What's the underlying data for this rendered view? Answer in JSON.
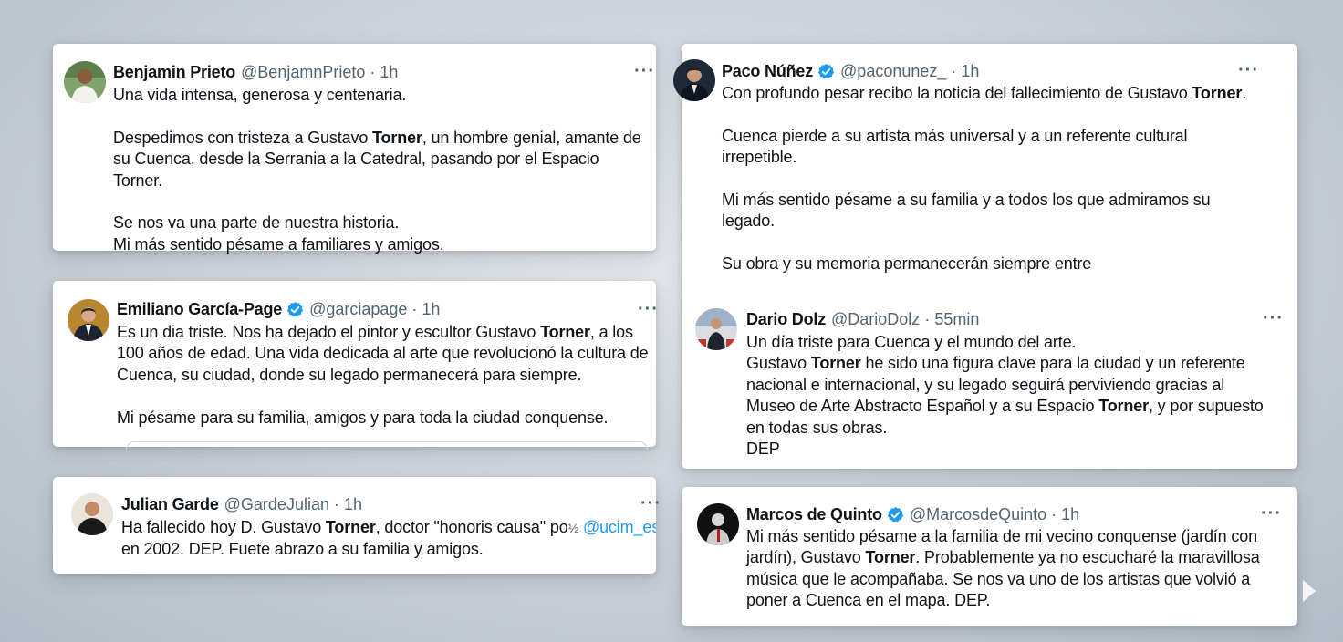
{
  "tweets": [
    {
      "name": "Benjamin Prieto",
      "handle": "@BenjamnPrieto",
      "time": "1h",
      "verified": false,
      "more": "···",
      "lines": [
        "Una vida intensa, generosa y centenaria."
      ],
      "p2_a": "Despedimos con tristeza a Gustavo ",
      "p2_b": "Torner",
      "p2_c": ", un hombre genial, amante de su Cuenca, desde la Serrania a la Catedral, pasando por el Espacio Torner.",
      "p3_l1": "Se nos va una parte de nuestra historia.",
      "p3_l2": "Mi más sentido pésame a familiares y amigos."
    },
    {
      "name": "Emiliano García-Page",
      "handle": "@garciapage",
      "time": "1h",
      "verified": true,
      "more": "···",
      "p1_a": "Es un dia triste. Nos ha dejado el pintor y escultor Gustavo ",
      "p1_b": "Torner",
      "p1_c": ", a los 100 años de edad. Una vida dedicada al arte que revolucionó la cultura de Cuenca, su ciudad, donde su legado permanecerá para siempre.",
      "p2": "Mi pésame para su familia, amigos y para toda la ciudad conquense."
    },
    {
      "name": "Julian Garde",
      "handle": "@GardeJulian",
      "time": "1h",
      "verified": false,
      "more": "···",
      "p1_a": "Ha fallecido hoy D. Gustavo ",
      "p1_b": "Torner",
      "p1_c": ", doctor \"honoris causa\" po",
      "p1_glyph": "½",
      "p1_mention": "@ucim_es",
      "p1_l2": "en 2002. DEP.  Fuete abrazo a su familia y amigos."
    },
    {
      "name": "Paco Núñez",
      "handle": "@paconunez_",
      "time": "1h",
      "verified": true,
      "more": "···",
      "p1_a": "Con profundo pesar recibo la noticia del fallecimiento de Gustavo ",
      "p1_b": "Torner",
      "p1_c": ".",
      "p2": "Cuenca pierde a su artista más universal y a un referente cultural irrepetible.",
      "p3": "Mi más sentido pésame a su familia y a todos los que admiramos su legado.",
      "p4": "Su obra y su memoria permanecerán siempre entre"
    },
    {
      "name": "Dario Dolz",
      "handle": "@DarioDolz",
      "time": "55min",
      "verified": false,
      "more": "···",
      "l1": "Un día triste para Cuenca y el mundo del arte.",
      "l2_a": "Gustavo ",
      "l2_b": "Torner",
      "l2_c": " he sido una figura clave para la ciudad y un referente nacional e internacional, y su legado seguirá perviviendo gracias al Museo de Arte Abstracto Español y a su Espacio ",
      "l2_d": "Torner",
      "l2_e": ", y por supuesto en todas sus obras.",
      "l3": "DEP"
    },
    {
      "name": "Marcos de Quinto",
      "handle": "@MarcosdeQuinto",
      "time": "1h",
      "verified": true,
      "more": "···",
      "p1_a": "Mi más sentido pésame a la familia de mi vecino conquense (jardín con jardín), Gustavo ",
      "p1_b": "Torner",
      "p1_c": ". Probablemente ya no escucharé la maravillosa música que le acompañaba. Se nos va uno de los artistas que volvió a poner a Cuenca en el mapa. DEP."
    }
  ],
  "colors": {
    "verified": "#1d9bf0",
    "mention": "#1d9bf0",
    "muted": "#536471"
  }
}
